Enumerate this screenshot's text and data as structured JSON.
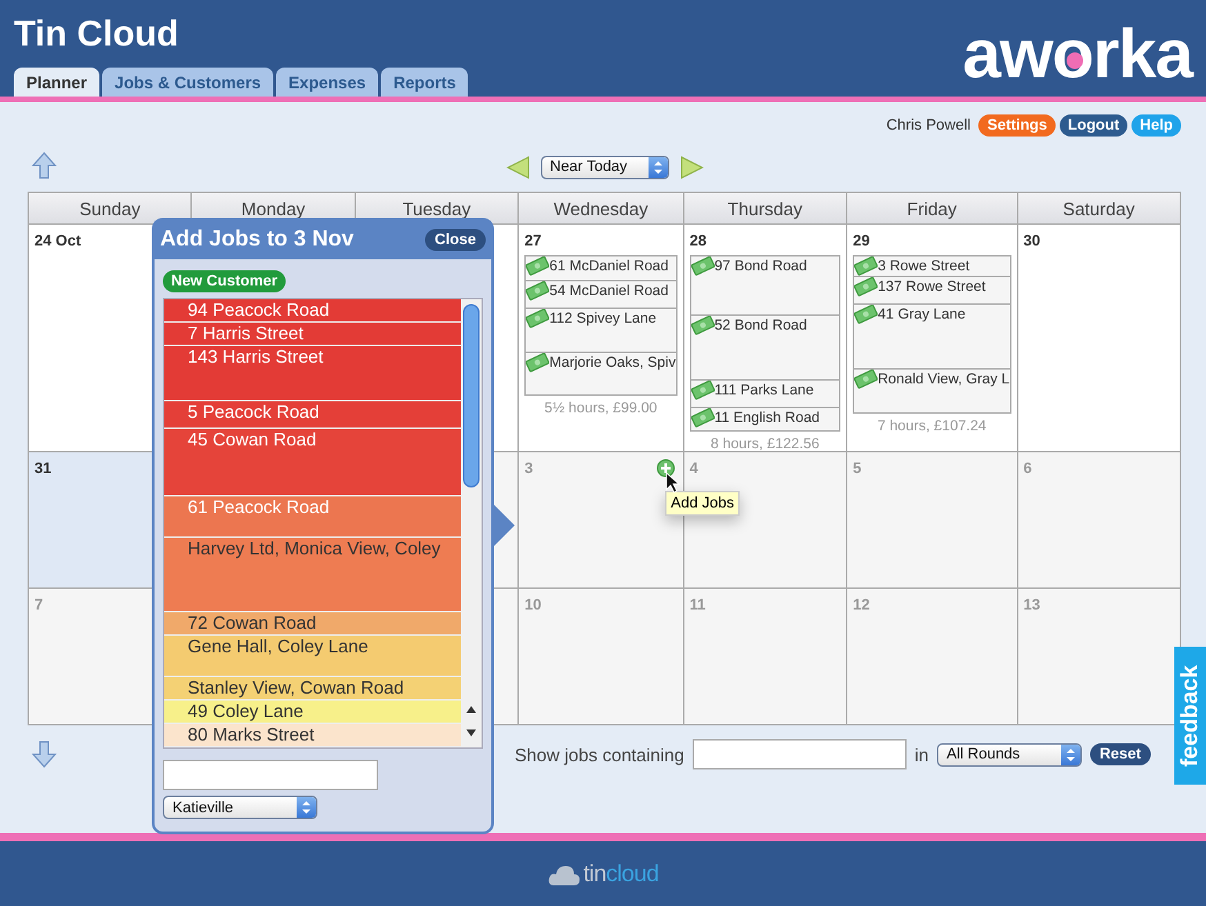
{
  "app_title": "Tin Cloud",
  "logo": "aworka",
  "tabs": [
    {
      "label": "Planner",
      "selected": true
    },
    {
      "label": "Jobs & Customers",
      "selected": false
    },
    {
      "label": "Expenses",
      "selected": false
    },
    {
      "label": "Reports",
      "selected": false
    }
  ],
  "user": {
    "name": "Chris Powell",
    "buttons": [
      {
        "label": "Settings",
        "color": "#f26a1f"
      },
      {
        "label": "Logout",
        "color": "#2d5b8f"
      },
      {
        "label": "Help",
        "color": "#1fa3ea"
      }
    ]
  },
  "range_select": "Near Today",
  "calendar": {
    "weekdays": [
      "Sunday",
      "Monday",
      "Tuesday",
      "Wednesday",
      "Thursday",
      "Friday",
      "Saturday"
    ],
    "weeks": [
      {
        "days": [
          {
            "date": "24 Oct",
            "current_month": true,
            "highlighted": false
          },
          {
            "date": "27",
            "current_month": true,
            "highlighted": false,
            "jobs": [
              "61 McDaniel Road",
              "54 McDaniel Road",
              "112 Spivey Lane",
              "Marjorie Oaks, Spiv"
            ],
            "summary": "5½ hours, £99.00"
          },
          {
            "date": "28",
            "current_month": true,
            "highlighted": false,
            "jobs": [
              "97 Bond Road",
              "52 Bond Road",
              "111 Parks Lane",
              "11 English Road"
            ],
            "summary": "8 hours, £122.56"
          },
          {
            "date": "29",
            "current_month": true,
            "highlighted": false,
            "jobs": [
              "3 Rowe Street",
              "137 Rowe Street",
              "41 Gray Lane",
              "Ronald View, Gray L"
            ],
            "summary": "7 hours, £107.24"
          },
          {
            "date": "30",
            "current_month": true,
            "highlighted": false
          }
        ]
      },
      {
        "days": [
          {
            "date": "31",
            "current_month": true,
            "highlighted": true
          },
          {
            "date": "3",
            "current_month": false,
            "highlighted": false,
            "hovered": true
          },
          {
            "date": "4",
            "current_month": false,
            "highlighted": false
          },
          {
            "date": "5",
            "current_month": false,
            "highlighted": false
          },
          {
            "date": "6",
            "current_month": false,
            "highlighted": false
          }
        ]
      },
      {
        "days": [
          {
            "date": "7",
            "current_month": false,
            "highlighted": false
          },
          {
            "date": "10",
            "current_month": false,
            "highlighted": false
          },
          {
            "date": "11",
            "current_month": false,
            "highlighted": false
          },
          {
            "date": "12",
            "current_month": false,
            "highlighted": false
          },
          {
            "date": "13",
            "current_month": false,
            "highlighted": false
          }
        ]
      }
    ]
  },
  "tooltip": "Add Jobs",
  "add_jobs_panel": {
    "title": "Add Jobs to 3 Nov",
    "close": "Close",
    "new_customer": "New Customer",
    "customers": [
      {
        "name": "94 Peacock Road",
        "color": "#e33b36"
      },
      {
        "name": "7 Harris Street",
        "color": "#e33b36"
      },
      {
        "name": "143 Harris Street",
        "color": "#e33b36"
      },
      {
        "name": "5 Peacock Road",
        "color": "#e43f38"
      },
      {
        "name": "45 Cowan Road",
        "color": "#e5443a"
      },
      {
        "name": "61 Peacock Road",
        "color": "#ec7650"
      },
      {
        "name": "Harvey Ltd, Monica View, Coley",
        "color": "#ee7c52"
      },
      {
        "name": "72 Cowan Road",
        "color": "#f0a96a"
      },
      {
        "name": "Gene Hall, Coley Lane",
        "color": "#f4cb70"
      },
      {
        "name": "Stanley View, Cowan Road",
        "color": "#f4d174"
      },
      {
        "name": "49 Coley Lane",
        "color": "#f7f08a"
      },
      {
        "name": "80 Marks Street",
        "color": "#fbe4cc"
      }
    ],
    "area_select": "Katieville"
  },
  "filter": {
    "label": "Show jobs containing",
    "in_label": "in",
    "rounds_select": "All Rounds",
    "reset": "Reset"
  },
  "feedback": "feedback",
  "footer_logo": [
    "tin",
    "cloud"
  ]
}
